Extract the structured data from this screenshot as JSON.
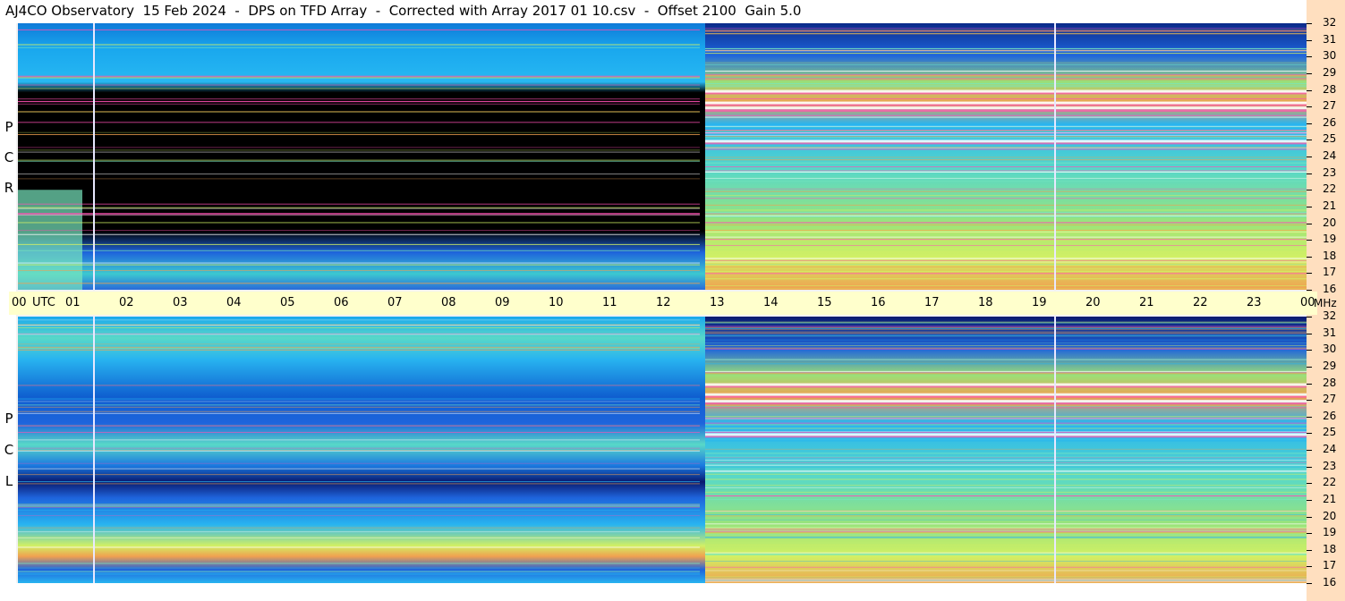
{
  "title": "AJ4CO Observatory  15 Feb 2024  -  DPS on TFD Array  -  Corrected with Array 2017 01 10.csv  -  Offset 2100  Gain 5.0",
  "time_axis": {
    "labels": [
      "00",
      "UTC",
      "01",
      "02",
      "03",
      "04",
      "05",
      "06",
      "07",
      "08",
      "09",
      "10",
      "11",
      "12",
      "13",
      "14",
      "15",
      "16",
      "17",
      "18",
      "19",
      "20",
      "21",
      "22",
      "23",
      "00",
      "MHz"
    ]
  },
  "panels": [
    {
      "polarization_letters": [
        "P",
        "C",
        "R"
      ]
    },
    {
      "polarization_letters": [
        "P",
        "C",
        "L"
      ]
    }
  ],
  "chart_data": [
    {
      "type": "heatmap",
      "description_source": "RCP spectrogram",
      "x_axis": {
        "unit": "UTC hour",
        "range": [
          0,
          24
        ],
        "ticks": [
          "00",
          "01",
          "02",
          "03",
          "04",
          "05",
          "06",
          "07",
          "08",
          "09",
          "10",
          "11",
          "12",
          "13",
          "14",
          "15",
          "16",
          "17",
          "18",
          "19",
          "20",
          "21",
          "22",
          "23",
          "00"
        ]
      },
      "y_axis": {
        "unit": "MHz",
        "range": [
          16,
          32
        ],
        "ticks": [
          16,
          17,
          18,
          19,
          20,
          21,
          22,
          23,
          24,
          25,
          26,
          27,
          28,
          29,
          30,
          31,
          32
        ]
      },
      "colormap": [
        "#000000",
        "#0a1a6e",
        "#1e64dc",
        "#28b4f0",
        "#78e6be",
        "#d2f064",
        "#f0a050",
        "#ff50b4",
        "#ffffff"
      ],
      "features": [
        {
          "label": "night low-power region",
          "x": [
            1.4,
            12.7
          ],
          "y": [
            17,
            27
          ]
        },
        {
          "label": "daytime high-power region",
          "x": [
            12.8,
            24
          ],
          "y": [
            16,
            32
          ]
        },
        {
          "label": "vertical gap line",
          "x": [
            1.4,
            1.4
          ]
        },
        {
          "label": "vertical gap line",
          "x": [
            19.3,
            19.3
          ]
        }
      ]
    },
    {
      "type": "heatmap",
      "description_source": "LCP spectrogram",
      "x_axis": {
        "unit": "UTC hour",
        "range": [
          0,
          24
        ]
      },
      "y_axis": {
        "unit": "MHz",
        "range": [
          16,
          32
        ],
        "ticks": [
          16,
          17,
          18,
          19,
          20,
          21,
          22,
          23,
          24,
          25,
          26,
          27,
          28,
          29,
          30,
          31,
          32
        ]
      },
      "features": [
        {
          "label": "night banded region",
          "x": [
            0,
            12.8
          ],
          "y": [
            16,
            32
          ]
        },
        {
          "label": "daytime high-power region",
          "x": [
            12.8,
            24
          ],
          "y": [
            16,
            32
          ]
        },
        {
          "label": "vertical gap line",
          "x": [
            1.4,
            1.4
          ]
        },
        {
          "label": "vertical gap line",
          "x": [
            19.3,
            19.3
          ]
        }
      ]
    }
  ]
}
